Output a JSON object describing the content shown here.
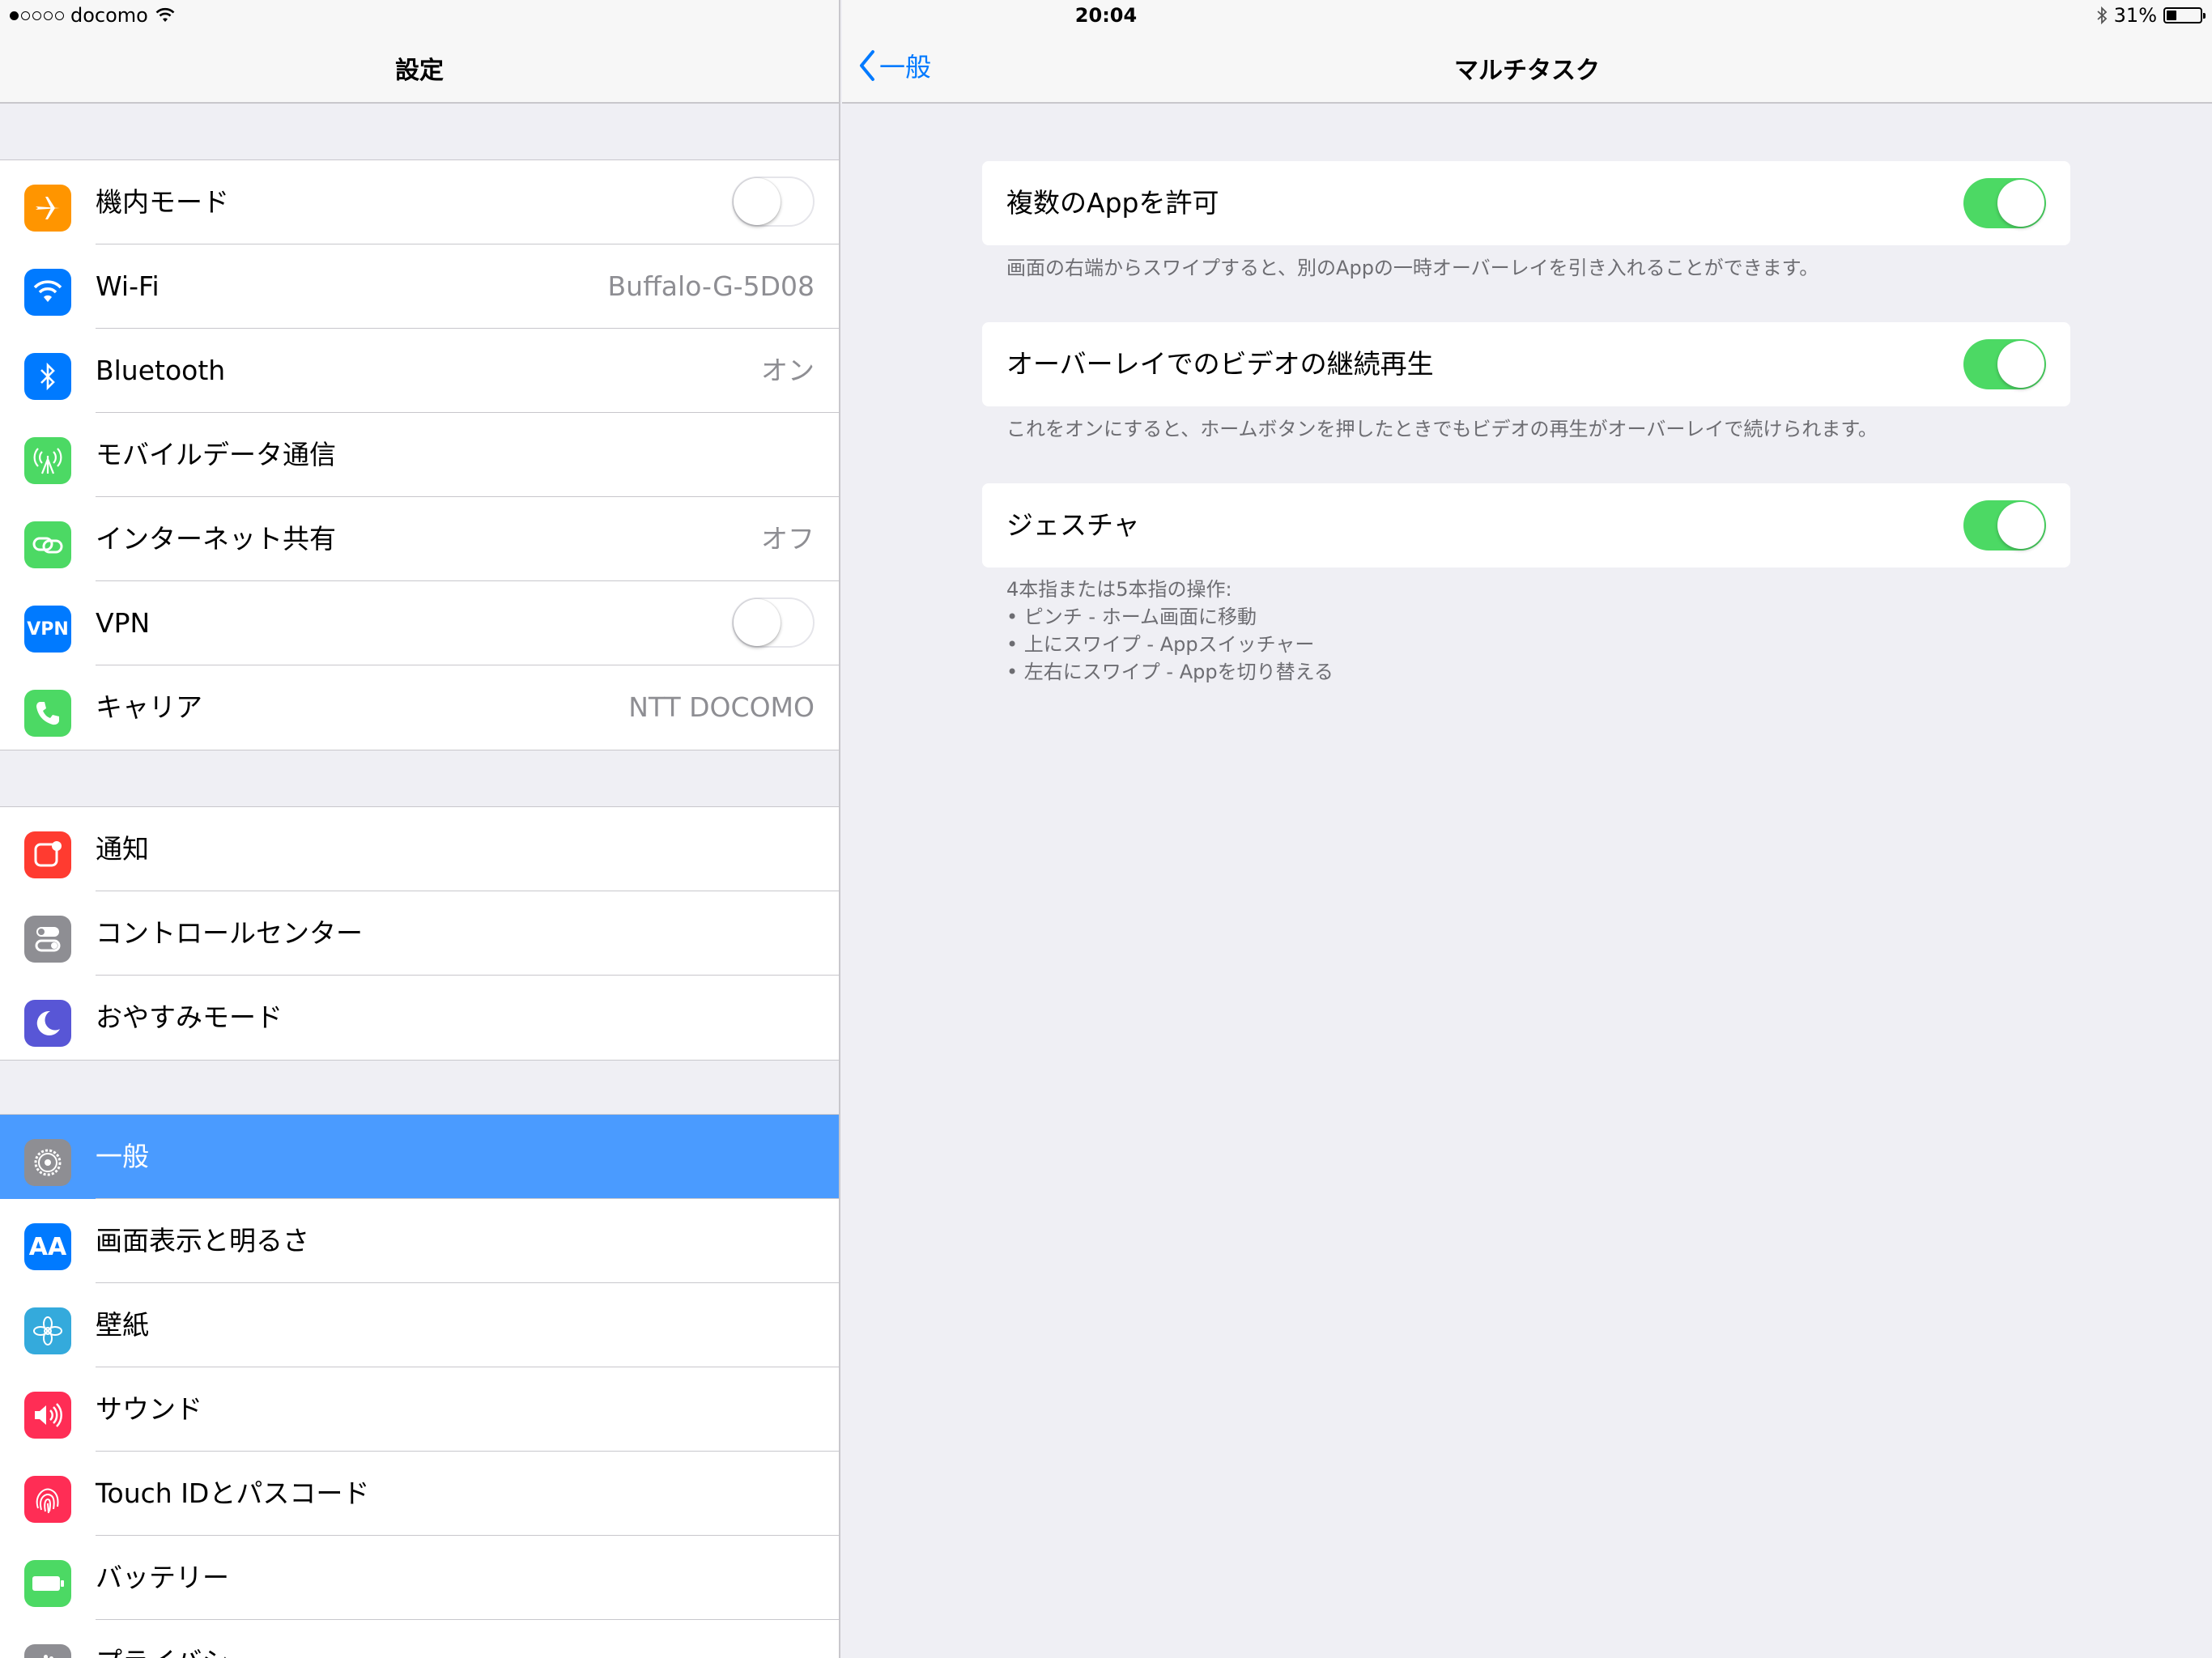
{
  "status": {
    "carrier": "docomo",
    "time": "20:04",
    "battery_text": "31%",
    "battery_level": 0.31
  },
  "master": {
    "title": "設定",
    "groups": [
      [
        {
          "label": "機内モード",
          "icon": "airplane-icon",
          "color": "#ff9500",
          "toggle": false
        },
        {
          "label": "Wi-Fi",
          "icon": "wifi-icon",
          "color": "#007aff",
          "value": "Buffalo-G-5D08"
        },
        {
          "label": "Bluetooth",
          "icon": "bluetooth-icon",
          "color": "#007aff",
          "value": "オン"
        },
        {
          "label": "モバイルデータ通信",
          "icon": "cellular-icon",
          "color": "#4cd964"
        },
        {
          "label": "インターネット共有",
          "icon": "hotspot-icon",
          "color": "#4cd964",
          "value": "オフ"
        },
        {
          "label": "VPN",
          "icon": "vpn-icon",
          "icon_text": "VPN",
          "color": "#007aff",
          "toggle": false
        },
        {
          "label": "キャリア",
          "icon": "phone-icon",
          "color": "#4cd964",
          "value": "NTT DOCOMO"
        }
      ],
      [
        {
          "label": "通知",
          "icon": "notifications-icon",
          "color": "#ff3b30"
        },
        {
          "label": "コントロールセンター",
          "icon": "control-center-icon",
          "color": "#8e8e93"
        },
        {
          "label": "おやすみモード",
          "icon": "moon-icon",
          "color": "#5856d6"
        }
      ],
      [
        {
          "label": "一般",
          "icon": "gear-icon",
          "color": "#8e8e93",
          "selected": true
        },
        {
          "label": "画面表示と明るさ",
          "icon": "display-icon",
          "icon_text": "AA",
          "color": "#007aff"
        },
        {
          "label": "壁紙",
          "icon": "wallpaper-icon",
          "color": "#34aadc"
        },
        {
          "label": "サウンド",
          "icon": "sound-icon",
          "color": "#ff2d55"
        },
        {
          "label": "Touch IDとパスコード",
          "icon": "fingerprint-icon",
          "color": "#ff2d55"
        },
        {
          "label": "バッテリー",
          "icon": "battery-icon",
          "color": "#4cd964"
        },
        {
          "label": "プライバシー",
          "icon": "privacy-icon",
          "color": "#8e8e93"
        }
      ]
    ]
  },
  "detail": {
    "title": "マルチタスク",
    "back_label": "一般",
    "settings": [
      {
        "label": "複数のAppを許可",
        "on": true,
        "footer": [
          "画面の右端からスワイプすると、別のAppの一時オーバーレイを引き入れることができます。"
        ]
      },
      {
        "label": "オーバーレイでのビデオの継続再生",
        "on": true,
        "footer": [
          "これをオンにすると、ホームボタンを押したときでもビデオの再生がオーバーレイで続けられます。"
        ]
      },
      {
        "label": "ジェスチャ",
        "on": true,
        "footer": [
          "4本指または5本指の操作:",
          "• ピンチ - ホーム画面に移動",
          "• 上にスワイプ - Appスイッチャー",
          "• 左右にスワイプ - Appを切り替える"
        ]
      }
    ]
  }
}
